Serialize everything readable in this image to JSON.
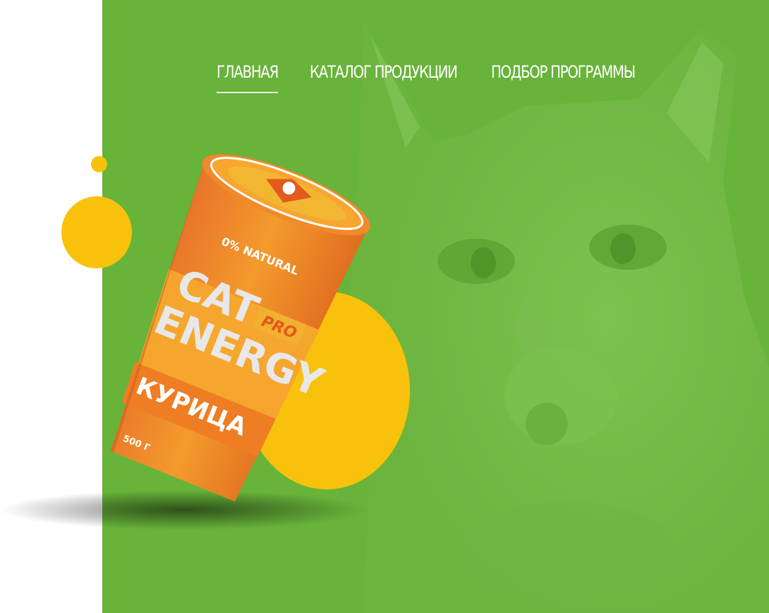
{
  "nav": {
    "items": [
      {
        "label": "ГЛАВНАЯ",
        "active": true
      },
      {
        "label": "КАТАЛОГ ПРОДУКЦИИ",
        "active": false
      },
      {
        "label": "ПОДБОР ПРОГРАММЫ",
        "active": false
      }
    ]
  },
  "product": {
    "tag": "0% NATURAL",
    "brand_line1": "CAT",
    "brand_line2": "ENERGY",
    "badge": "PRO",
    "flavor": "КУРИЦА",
    "weight": "500 Г"
  },
  "colors": {
    "green": "#68b33a",
    "yellow": "#f8c20c",
    "orange": "#f07d1e"
  }
}
